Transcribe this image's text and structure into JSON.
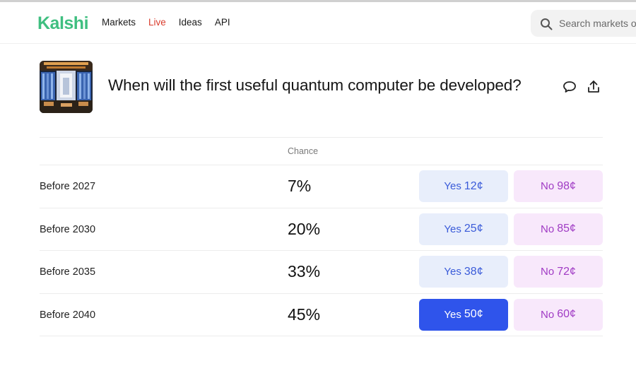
{
  "brand": {
    "name": "Kalshi",
    "color": "#3fbf80"
  },
  "nav": [
    {
      "label": "Markets"
    },
    {
      "label": "Live",
      "color": "#d93c2d"
    },
    {
      "label": "Ideas"
    },
    {
      "label": "API"
    }
  ],
  "search": {
    "placeholder": "Search markets or",
    "icon": "search-icon"
  },
  "event": {
    "title": "When will the first useful quantum computer be developed?",
    "thumbnail": "quantum-computer-photo",
    "actions": {
      "comment_icon": "comment-icon",
      "share_icon": "share-icon"
    }
  },
  "table": {
    "chance_header": "Chance",
    "rows": [
      {
        "label": "Before 2027",
        "chance": "7%",
        "yes_label": "Yes",
        "yes_price": "12¢",
        "no_label": "No",
        "no_price": "98¢"
      },
      {
        "label": "Before 2030",
        "chance": "20%",
        "yes_label": "Yes",
        "yes_price": "25¢",
        "no_label": "No",
        "no_price": "85¢"
      },
      {
        "label": "Before 2035",
        "chance": "33%",
        "yes_label": "Yes",
        "yes_price": "38¢",
        "no_label": "No",
        "no_price": "72¢"
      },
      {
        "label": "Before 2040",
        "chance": "45%",
        "yes_label": "Yes",
        "yes_price": "50¢",
        "no_label": "No",
        "no_price": "60¢",
        "yes_selected": true
      }
    ]
  },
  "colors": {
    "yes_bg": "#e8eefb",
    "yes_text": "#3a5bd9",
    "no_bg": "#f8e8fb",
    "no_text": "#a03bc4",
    "yes_active": "#2f54eb"
  }
}
